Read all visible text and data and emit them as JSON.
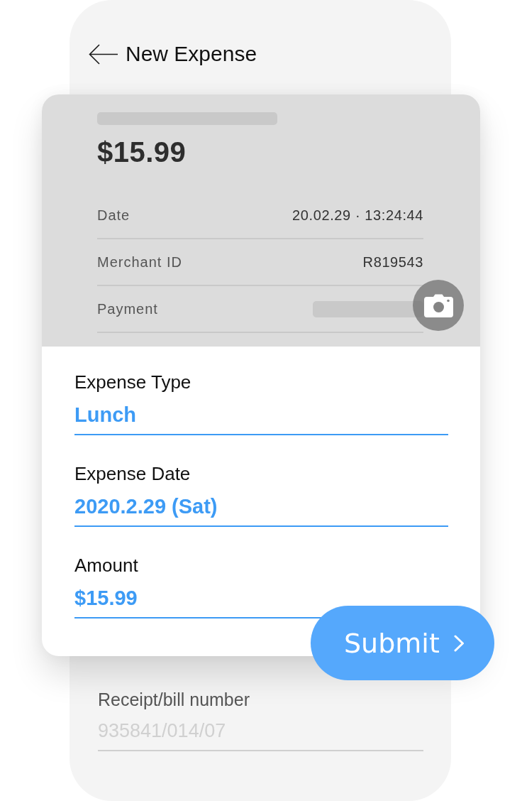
{
  "header": {
    "title": "New Expense"
  },
  "receipt": {
    "amount": "$15.99",
    "rows": [
      {
        "label": "Date",
        "kind": "text",
        "value": "20.02.29 · 13:24:44"
      },
      {
        "label": "Merchant ID",
        "kind": "text",
        "value": "R819543"
      },
      {
        "label": "Payment",
        "kind": "redacted"
      }
    ]
  },
  "form": {
    "fields": [
      {
        "label": "Expense Type",
        "value": "Lunch"
      },
      {
        "label": "Expense Date",
        "value": "2020.2.29 (Sat)"
      },
      {
        "label": "Amount",
        "value": "$15.99"
      }
    ]
  },
  "submit": {
    "label": "Submit"
  },
  "receipt_number": {
    "label": "Receipt/bill number",
    "placeholder": "935841/014/07"
  }
}
